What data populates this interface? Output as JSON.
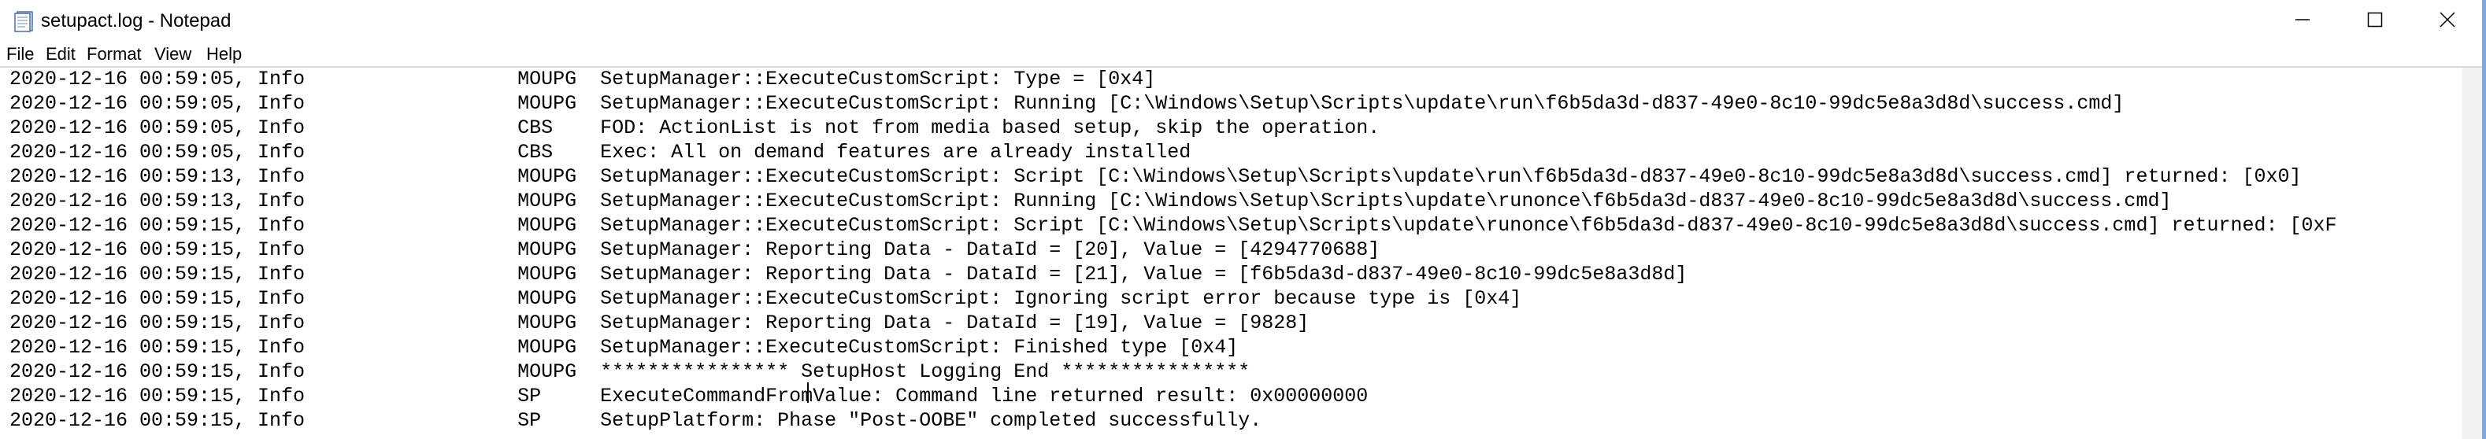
{
  "window": {
    "title": "setupact.log - Notepad"
  },
  "menu": [
    {
      "label": "File"
    },
    {
      "label": "Edit"
    },
    {
      "label": "Format"
    },
    {
      "label": "View"
    },
    {
      "label": "Help"
    }
  ],
  "editor": {
    "lines": [
      "2020-12-16 00:59:05, Info                  MOUPG  SetupManager::ExecuteCustomScript: Type = [0x4]",
      "2020-12-16 00:59:05, Info                  MOUPG  SetupManager::ExecuteCustomScript: Running [C:\\Windows\\Setup\\Scripts\\update\\run\\f6b5da3d-d837-49e0-8c10-99dc5e8a3d8d\\success.cmd]",
      "2020-12-16 00:59:05, Info                  CBS    FOD: ActionList is not from media based setup, skip the operation.",
      "2020-12-16 00:59:05, Info                  CBS    Exec: All on demand features are already installed",
      "2020-12-16 00:59:13, Info                  MOUPG  SetupManager::ExecuteCustomScript: Script [C:\\Windows\\Setup\\Scripts\\update\\run\\f6b5da3d-d837-49e0-8c10-99dc5e8a3d8d\\success.cmd] returned: [0x0]",
      "2020-12-16 00:59:13, Info                  MOUPG  SetupManager::ExecuteCustomScript: Running [C:\\Windows\\Setup\\Scripts\\update\\runonce\\f6b5da3d-d837-49e0-8c10-99dc5e8a3d8d\\success.cmd]",
      "2020-12-16 00:59:15, Info                  MOUPG  SetupManager::ExecuteCustomScript: Script [C:\\Windows\\Setup\\Scripts\\update\\runonce\\f6b5da3d-d837-49e0-8c10-99dc5e8a3d8d\\success.cmd] returned: [0xF",
      "2020-12-16 00:59:15, Info                  MOUPG  SetupManager: Reporting Data - DataId = [20], Value = [4294770688]",
      "2020-12-16 00:59:15, Info                  MOUPG  SetupManager: Reporting Data - DataId = [21], Value = [f6b5da3d-d837-49e0-8c10-99dc5e8a3d8d]",
      "2020-12-16 00:59:15, Info                  MOUPG  SetupManager::ExecuteCustomScript: Ignoring script error because type is [0x4]",
      "2020-12-16 00:59:15, Info                  MOUPG  SetupManager: Reporting Data - DataId = [19], Value = [9828]",
      "2020-12-16 00:59:15, Info                  MOUPG  SetupManager::ExecuteCustomScript: Finished type [0x4]",
      "2020-12-16 00:59:15, Info                  MOUPG  **************** SetupHost Logging End ****************",
      "2020-12-16 00:59:15, Info                  SP     ExecuteCommandFromValue: Command line returned result: 0x00000000",
      "2020-12-16 00:59:15, Info                  SP     SetupPlatform: Phase \"Post-OOBE\" completed successfully."
    ]
  },
  "icons": {
    "app": "notepad-icon",
    "minimize": "minimize-icon",
    "maximize": "maximize-icon",
    "close": "close-icon"
  }
}
